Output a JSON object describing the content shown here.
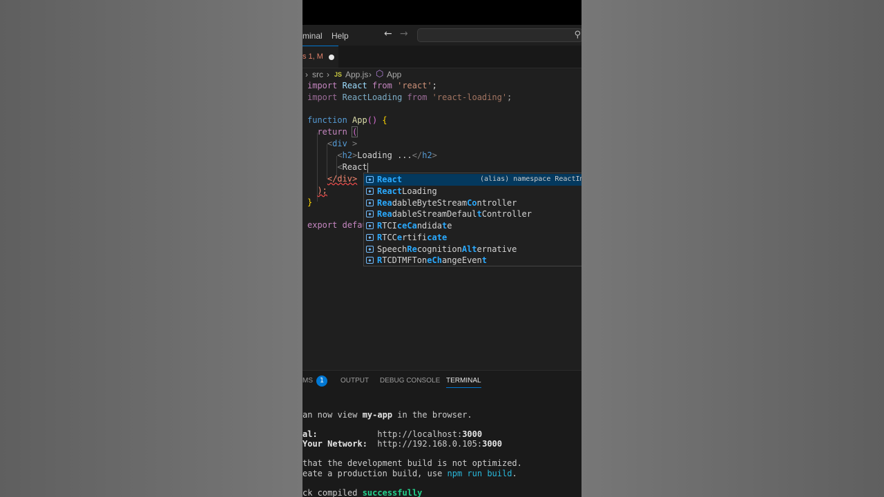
{
  "menubar": {
    "terminal_label": "minal",
    "help_label": "Help",
    "back_icon": "←",
    "forward_icon": "→",
    "search_placeholder": "",
    "search_icon": "⚲"
  },
  "tab": {
    "label": "s 1, M"
  },
  "breadcrumb": {
    "sep": "›",
    "src": "src",
    "js_badge": "JS",
    "file": "App.js",
    "symbol": "App"
  },
  "code": {
    "l1_kw": "import",
    "l1_id": "React",
    "l1_from": "from",
    "l1_str": "'react'",
    "l1_end": ";",
    "l2_kw": "import",
    "l2_id": "ReactLoading",
    "l2_from": "from",
    "l2_str": "'react-loading'",
    "l2_end": ";",
    "l4_kw": "function",
    "l4_name": "App",
    "l4_paren": "()",
    "l4_brace": "{",
    "l5_kw": "return",
    "l5_paren": "(",
    "l6_open": "<",
    "l6_tag": "div",
    "l6_close": " >",
    "l7_open": "<",
    "l7_tag": "h2",
    "l7_gt": ">",
    "l7_text": "Loading ...",
    "l7_close_open": "</",
    "l7_close_tag": "h2",
    "l7_close_gt": ">",
    "l8_open": "<",
    "l8_typed": "React",
    "l9_close": "</div>",
    "l10_text": ");",
    "l11_text": "}",
    "l13_kw": "export",
    "l13_rest": "defau"
  },
  "suggestions": [
    {
      "m": "React",
      "r": "",
      "selected": true,
      "detail": "(alias) namespace ReactImp"
    },
    {
      "m": "React",
      "r": "Loading"
    },
    {
      "m": "Rea",
      "r": "dableByteStream",
      "m2": "Co",
      "r2": "ntroller"
    },
    {
      "m": "Rea",
      "r": "dableStreamDefaul",
      "m2": "t",
      "r2": "Controller"
    },
    {
      "m": "R",
      "r": "TCI",
      "m2": "ceCa",
      "r2": "ndida",
      "m3": "t",
      "r3": "e"
    },
    {
      "m": "R",
      "r": "TCC",
      "m2": "e",
      "r2": "rtifi",
      "m3": "cate",
      "r3": ""
    },
    {
      "m": "",
      "r": "Speech",
      "m2": "Re",
      "r2": "cognition",
      "m3": "Alt",
      "r3": "ernative"
    },
    {
      "m": "R",
      "r": "TCDTMFTon",
      "m2": "eCh",
      "r2": "angeEven",
      "m3": "t",
      "r3": ""
    }
  ],
  "panel": {
    "problems_label": "MS",
    "problems_count": "1",
    "output_label": "OUTPUT",
    "debug_label": "DEBUG CONSOLE",
    "terminal_label": "TERMINAL"
  },
  "terminal": {
    "l1a": "an now view ",
    "l1b": "my-app",
    "l1c": " in the browser.",
    "l2a": "al:",
    "l2b": "            http://localhost:",
    "l2c": "3000",
    "l3a": "Your Network:",
    "l3b": "  http://192.168.0.105:",
    "l3c": "3000",
    "l4": "that the development build is not optimized.",
    "l5a": "eate a production build, use ",
    "l5b": "npm run build",
    "l5c": ".",
    "l6a": "ck compiled ",
    "l6b": "successfully"
  },
  "colors": {
    "accent": "#0078d4",
    "editor_bg": "#1f1f1f",
    "suggest_highlight": "#2aaaff",
    "success": "#23d18b"
  }
}
